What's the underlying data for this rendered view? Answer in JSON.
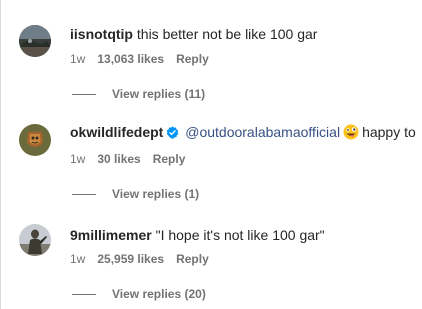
{
  "comments": [
    {
      "username": "iisnotqtip",
      "text": "this better not be like 100 gar",
      "age": "1w",
      "likes": "13,063 likes",
      "reply_label": "Reply",
      "view_replies": "View replies (11)",
      "avatar_icon": "profile-photo"
    },
    {
      "username": "okwildlifedept",
      "verified": true,
      "mention": "@outdooralabamaofficial",
      "emoji": "zany-face",
      "text": "happy to",
      "age": "1w",
      "likes": "30 likes",
      "reply_label": "Reply",
      "view_replies": "View replies (1)",
      "avatar_icon": "wildlife-dept-logo"
    },
    {
      "username": "9millimemer",
      "text": "\"I hope it's not like 100 gar\"",
      "age": "1w",
      "likes": "25,959 likes",
      "reply_label": "Reply",
      "view_replies": "View replies (20)",
      "avatar_icon": "profile-photo"
    }
  ],
  "colors": {
    "text": "#262626",
    "secondary": "#737373",
    "mention": "#385185",
    "verified": "#0095f6"
  }
}
